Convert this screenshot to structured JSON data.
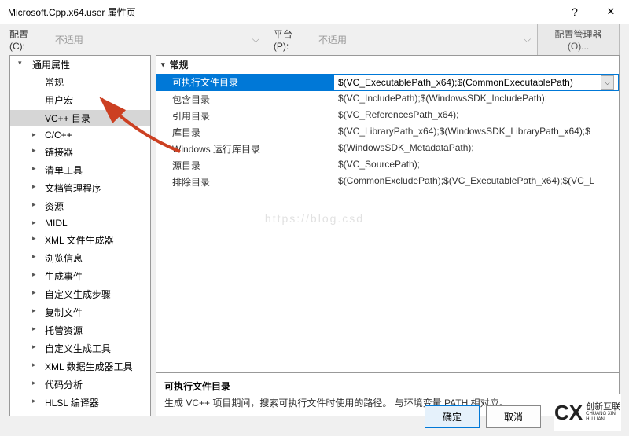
{
  "title": "Microsoft.Cpp.x64.user 属性页",
  "toolbar": {
    "config_label": "配置(C):",
    "config_value": "不适用",
    "platform_label": "平台(P):",
    "platform_value": "不适用",
    "manager_btn": "配置管理器(O)..."
  },
  "tree": {
    "root": "通用属性",
    "items_plain": {
      "general": "常规",
      "usermacro": "用户宏",
      "vcdirs": "VC++ 目录"
    },
    "items_exp": [
      "C/C++",
      "链接器",
      "清单工具",
      "文档管理程序",
      "资源",
      "MIDL",
      "XML 文件生成器",
      "浏览信息",
      "生成事件",
      "自定义生成步骤",
      "复制文件",
      "托管资源",
      "自定义生成工具",
      "XML 数据生成器工具",
      "代码分析",
      "HLSL 编译器"
    ],
    "selected": "VC++ 目录"
  },
  "grid": {
    "section": "常规",
    "selected_index": 0,
    "rows": [
      {
        "label": "可执行文件目录",
        "value": "$(VC_ExecutablePath_x64);$(CommonExecutablePath)"
      },
      {
        "label": "包含目录",
        "value": "$(VC_IncludePath);$(WindowsSDK_IncludePath);"
      },
      {
        "label": "引用目录",
        "value": "$(VC_ReferencesPath_x64);"
      },
      {
        "label": "库目录",
        "value": "$(VC_LibraryPath_x64);$(WindowsSDK_LibraryPath_x64);$"
      },
      {
        "label": "Windows 运行库目录",
        "value": "$(WindowsSDK_MetadataPath);"
      },
      {
        "label": "源目录",
        "value": "$(VC_SourcePath);"
      },
      {
        "label": "排除目录",
        "value": "$(CommonExcludePath);$(VC_ExecutablePath_x64);$(VC_L"
      }
    ]
  },
  "description": {
    "title": "可执行文件目录",
    "text": "生成 VC++ 项目期间，搜索可执行文件时使用的路径。    与环境变量 PATH 相对应。"
  },
  "buttons": {
    "ok": "确定",
    "cancel": "取消"
  },
  "watermark": "https://blog.csd",
  "logo": {
    "mark": "CX",
    "line1": "创新互联",
    "line2": "CHUANG XIN HU LIAN"
  }
}
